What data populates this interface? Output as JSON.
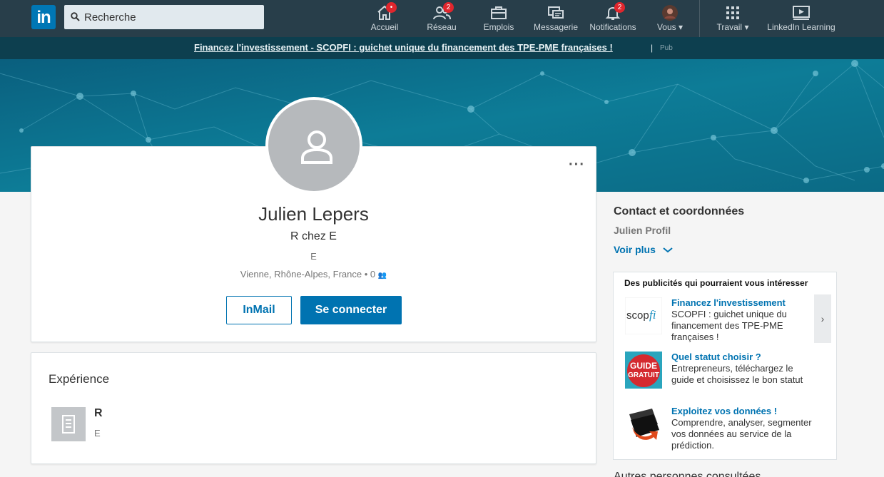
{
  "nav": {
    "logo": "in",
    "search_placeholder": "Recherche",
    "items": [
      {
        "label": "Accueil",
        "icon": "home-icon",
        "badge": "•"
      },
      {
        "label": "Réseau",
        "icon": "network-icon",
        "badge": "2"
      },
      {
        "label": "Emplois",
        "icon": "briefcase-icon",
        "badge": ""
      },
      {
        "label": "Messagerie",
        "icon": "messaging-icon",
        "badge": ""
      },
      {
        "label": "Notifications",
        "icon": "bell-icon",
        "badge": "2"
      },
      {
        "label": "Vous",
        "icon": "avatar-icon",
        "badge": ""
      },
      {
        "label": "Travail",
        "icon": "grid-icon",
        "badge": ""
      },
      {
        "label": "LinkedIn Learning",
        "icon": "learning-icon",
        "badge": ""
      }
    ]
  },
  "adstrip": {
    "link": "Financez l'investissement - SCOPFI : guichet unique du financement des TPE-PME françaises !",
    "separator": "|",
    "pub": "Pub"
  },
  "profile": {
    "name": "Julien Lepers",
    "headline": "R chez E",
    "company": "E",
    "location": "Vienne, Rhône-Alpes, France",
    "connections": "• 0",
    "inmail_label": "InMail",
    "connect_label": "Se connecter",
    "more_label": "···"
  },
  "experience": {
    "title": "Expérience",
    "role": "R",
    "company": "E"
  },
  "contact": {
    "title": "Contact et coordonnées",
    "name": "Julien Profil",
    "more": "Voir plus"
  },
  "ads": {
    "title": "Des publicités qui pourraient vous intéresser",
    "arrow": "›",
    "items": [
      {
        "title": "Financez l'investissement",
        "desc": "SCOPFI : guichet unique du financement des TPE-PME françaises !",
        "logo": "scopfi"
      },
      {
        "title": "Quel statut choisir ?",
        "desc": "Entrepreneurs, téléchargez le guide et choisissez le bon statut",
        "logo_line1": "GUIDE",
        "logo_line2": "GRATUIT"
      },
      {
        "title": "Exploitez vos données !",
        "desc": "Comprendre, analyser, segmenter vos données au service de la prédiction.",
        "logo": "data-arrow-icon"
      }
    ]
  },
  "below": {
    "text": "Autres personnes consultées"
  },
  "colors": {
    "nav_bg": "#283e4a",
    "brand_blue": "#0073b1",
    "badge_red": "#e0262d"
  }
}
